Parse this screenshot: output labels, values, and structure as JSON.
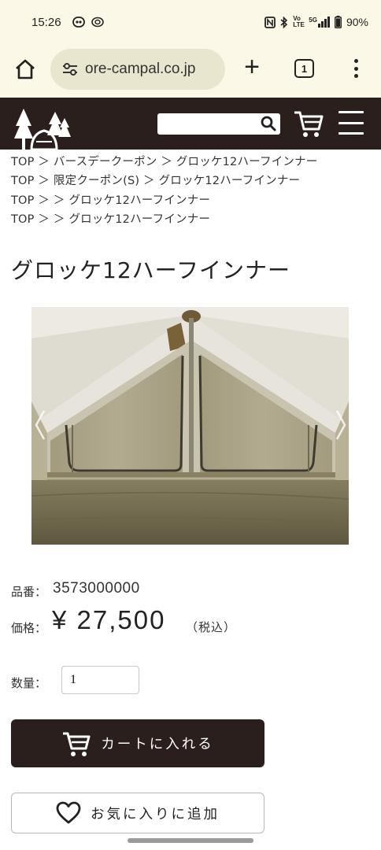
{
  "status_bar": {
    "time": "15:26",
    "battery": "90%",
    "left_icons": [
      "clock-face-icon",
      "car-icon"
    ],
    "right_icons": [
      "nfc-icon",
      "bluetooth-icon",
      "volte-icon",
      "5g-signal-icon",
      "battery-icon"
    ],
    "volte_label": "Vo LTE",
    "network_label": "5G"
  },
  "browser": {
    "url": "ore-campal.co.jp",
    "tab_count": "1",
    "plus_label": "+"
  },
  "breadcrumbs": [
    "TOP ＞ バースデークーポン ＞ グロッケ12ハーフインナー",
    "TOP ＞ 限定クーポン(S) ＞ グロッケ12ハーフインナー",
    "TOP ＞ ＞ グロッケ12ハーフインナー",
    "TOP ＞ ＞ グロッケ12ハーフインナー"
  ],
  "product": {
    "title": "グロッケ12ハーフインナー",
    "code_label": "品番：",
    "code": "3573000000",
    "price_label": "価格：",
    "price": "¥ 27,500",
    "tax_note": "（税込）",
    "qty_label": "数量：",
    "qty_value": "1"
  },
  "buttons": {
    "add_to_cart": "カートに入れる",
    "add_to_favorites": "お気に入りに追加"
  },
  "colors": {
    "header_bg": "#2a1f1c",
    "browser_bg": "#fbf8e8",
    "url_pill_bg": "#e9e6cf"
  }
}
